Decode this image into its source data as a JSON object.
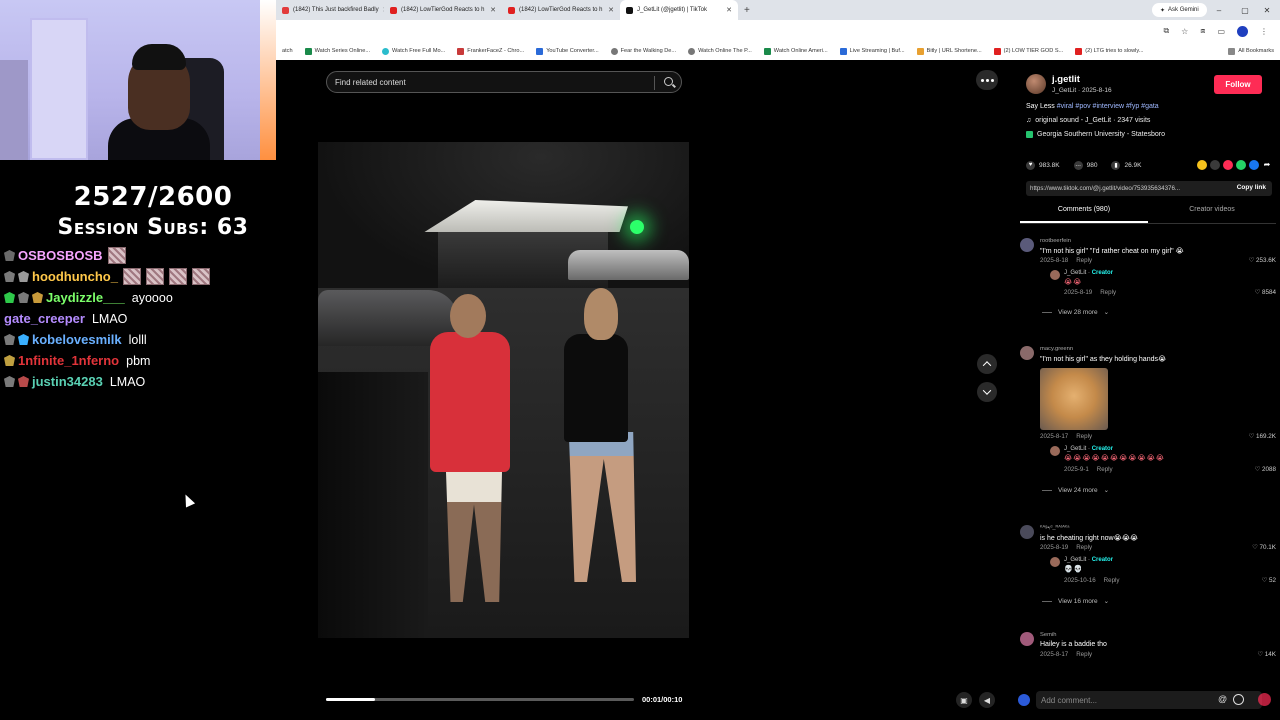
{
  "browser": {
    "tabs": [
      {
        "label": "(1842) This Just backfired Badly",
        "color": "#e23b3b"
      },
      {
        "label": "(1842) LowTierGod Reacts to h",
        "color": "#e02020"
      },
      {
        "label": "(1842) LowTierGod Reacts to h",
        "color": "#e02020"
      },
      {
        "label": "J_GetLit (@jgetlit) | TikTok",
        "color": "#111111"
      }
    ],
    "new_tab": "+",
    "ask_gemini": "Ask Gemini",
    "bookmarks": [
      "atch",
      "Watch Series Online...",
      "Watch Free Full Mo...",
      "FrankerFaceZ - Chro...",
      "YouTube Converter...",
      "Fear the Walking De...",
      "Watch Online The P...",
      "Watch Online Ameri...",
      "Live Streaming | Buf...",
      "Bitly | URL Shortene...",
      "(2) LOW TIER GOD S...",
      "(2) LTG tries to slowly..."
    ],
    "all_bookmarks": "All Bookmarks"
  },
  "overlay": {
    "sub_goal": "2527/2600",
    "session_subs": "Session Subs: 63"
  },
  "chat": [
    {
      "user": "OSBOSBOSB",
      "color": "#f7a6ff",
      "text": "",
      "badges": [
        "#6a6a6a"
      ],
      "emotes": 1
    },
    {
      "user": "hoodhuncho_",
      "color": "#ffc84a",
      "text": "",
      "badges": [
        "#7a7a7a",
        "#9a9a9a"
      ],
      "emotes": 4
    },
    {
      "user": "Jaydizzle___",
      "color": "#7cff6a",
      "text": "ayoooo",
      "badges": [
        "#2ec94a",
        "#7a7a7a",
        "#c89a3a"
      ],
      "emotes": 0
    },
    {
      "user": "gate_creeper",
      "color": "#b58cff",
      "text": "LMAO",
      "badges": [],
      "emotes": 0
    },
    {
      "user": "kobelovesmilk",
      "color": "#6ab0ff",
      "text": "lolll",
      "badges": [
        "#7a7a7a",
        "#3ab0ff"
      ],
      "emotes": 0
    },
    {
      "user": "1nfinite_1nferno",
      "color": "#e2343a",
      "text": "pbm",
      "badges": [
        "#c0a040"
      ],
      "emotes": 0
    },
    {
      "user": "justin34283",
      "color": "#5ad1b4",
      "text": "LMAO",
      "badges": [
        "#7a7a7a",
        "#b84a4a"
      ],
      "emotes": 0
    }
  ],
  "video": {
    "search_placeholder": "Find related content",
    "timecode": "00:01/00:10",
    "progress": 0.16
  },
  "post": {
    "username": "j.getlit",
    "subline": "J_GetLit · 2025-8-16",
    "follow": "Follow",
    "desc_prefix": "Say Less ",
    "desc_tags": "#viral #pov #interview #fyp #gata",
    "sound": "original sound - J_GetLit · 2347 visits",
    "location": "Georgia Southern University - Statesboro",
    "likes": "983.8K",
    "comments_count": "980",
    "saves": "26.9K",
    "link": "https://www.tiktok.com/@j.getlit/video/753935634376...",
    "copy_link": "Copy link",
    "tab_comments": "Comments (980)",
    "tab_creator": "Creator videos"
  },
  "comments": [
    {
      "user": "rootbeerfein",
      "text": "\"I'm not his girl\" \"I'd rather cheat on my girl\" 😭",
      "date": "2025-8-18",
      "reply": "Reply",
      "likes": "253.6K",
      "creator_reply": {
        "user": "J_GetLit",
        "tag": "Creator",
        "text": "😭😭",
        "date": "2025-8-19",
        "reply": "Reply",
        "likes": "8584"
      },
      "view_more": "View 28 more"
    },
    {
      "user": "macy.greenn",
      "text": "\"I'm not his girl\" as they holding hands😭",
      "date": "2025-8-17",
      "reply": "Reply",
      "likes": "169.2K",
      "creator_reply": {
        "user": "J_GetLit",
        "tag": "Creator",
        "text": "😭😭😭😭😭😭😭😭😭😭😭",
        "date": "2025-9-1",
        "reply": "Reply",
        "likes": "2088"
      },
      "view_more": "View 24 more"
    },
    {
      "user": "ᴷᴬᵍ•ᵢᵈ_ᴿᴬᵗᴬᴷᵃ",
      "text": "is he cheating right now😭😭😭",
      "date": "2025-8-19",
      "reply": "Reply",
      "likes": "70.1K",
      "creator_reply": {
        "user": "J_GetLit",
        "tag": "Creator",
        "text": "💀💀",
        "date": "2025-10-16",
        "reply": "Reply",
        "likes": "52"
      },
      "view_more": "View 16 more"
    },
    {
      "user": "Semih",
      "text": "Hailey is a baddie tho",
      "date": "2025-8-17",
      "reply": "Reply",
      "likes": "14K"
    }
  ],
  "add_comment_placeholder": "Add comment...",
  "colors": {
    "accent": "#fe2c55",
    "creator": "#25f4ee",
    "tags": "#9fb8ff"
  }
}
